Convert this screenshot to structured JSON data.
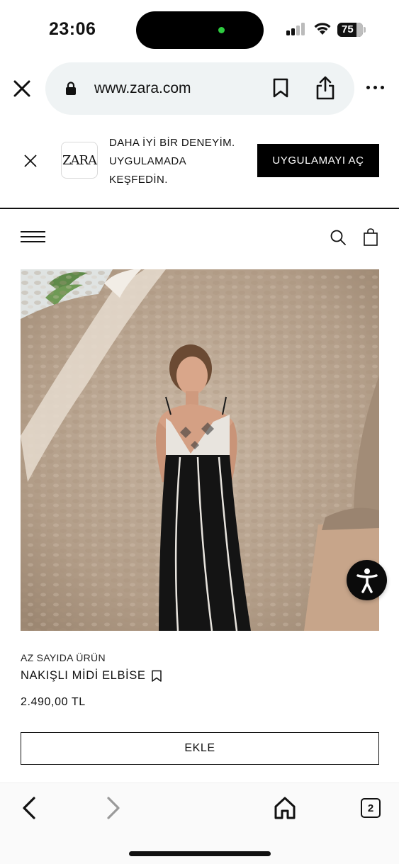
{
  "status_bar": {
    "time": "23:06",
    "battery_level": "75",
    "icons": [
      "cellular-signal-icon",
      "wifi-icon",
      "battery-icon"
    ]
  },
  "browser": {
    "url": "www.zara.com",
    "icons": [
      "close-icon",
      "lock-icon",
      "bookmark-icon",
      "share-icon",
      "more-icon"
    ]
  },
  "app_banner": {
    "logo": "ZARA",
    "message_lines": [
      "DAHA İYİ BİR DENEYİM.",
      "UYGULAMADA",
      "KEŞFEDİN."
    ],
    "open_button": "UYGULAMAYI AÇ"
  },
  "header": {
    "icons": [
      "menu-icon",
      "search-icon",
      "shopping-bag-icon"
    ]
  },
  "product": {
    "stock_label": "AZ SAYIDA ÜRÜN",
    "name": "NAKIŞLI MİDİ ELBİSE",
    "price": "2.490,00 TL",
    "add_button": "EKLE"
  },
  "toolbar": {
    "tab_count": "2",
    "icons": [
      "back-icon",
      "forward-icon",
      "home-icon",
      "tabs-icon"
    ]
  },
  "colors": {
    "accent": "#000000",
    "url_bar_bg": "#eff3f4",
    "island_dot": "#2ecc40"
  }
}
